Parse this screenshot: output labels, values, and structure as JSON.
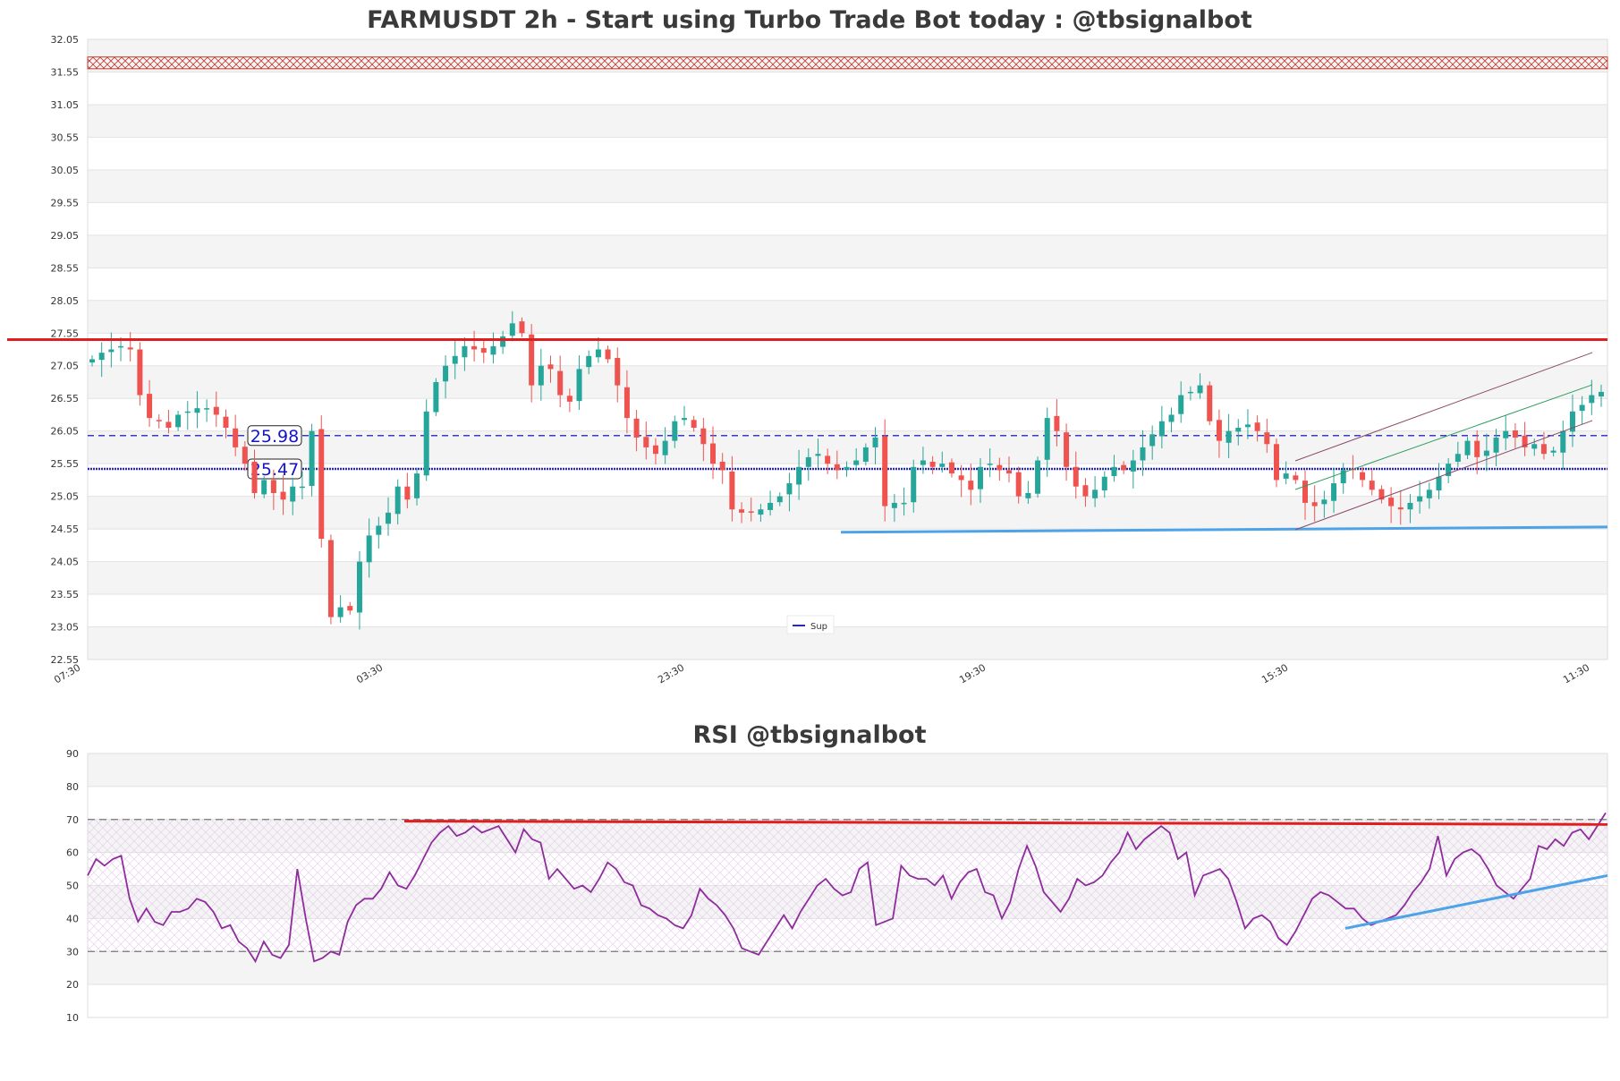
{
  "main_chart": {
    "title": "FARMUSDT 2h - Start using Turbo Trade Bot today : @tbsignalbot",
    "y_ticks": [
      "22.55",
      "23.05",
      "23.55",
      "24.05",
      "24.55",
      "25.05",
      "25.55",
      "26.05",
      "26.55",
      "27.05",
      "27.55",
      "28.05",
      "28.55",
      "29.05",
      "29.55",
      "30.05",
      "30.55",
      "31.05",
      "31.55",
      "32.05"
    ],
    "x_ticks": [
      "07:30",
      "03:30",
      "23:30",
      "19:30",
      "15:30",
      "11:30"
    ],
    "level_labels": [
      "25.98",
      "25.47"
    ],
    "legend_label": "Sup",
    "colors": {
      "up": "#26a69a",
      "down": "#ef5350",
      "resistance": "#e01e1e",
      "support_line": "#4da3e8",
      "level": "#2a2ab0",
      "zone": "#c0392b"
    }
  },
  "rsi_chart": {
    "title": "RSI @tbsignalbot",
    "y_ticks": [
      "10",
      "20",
      "30",
      "40",
      "50",
      "60",
      "70",
      "80",
      "90"
    ],
    "colors": {
      "rsi": "#8e2c9c",
      "resistance": "#e01e1e",
      "support_line": "#4da3e8",
      "band": "#777777"
    }
  },
  "chart_data": [
    {
      "type": "candlestick",
      "title": "FARMUSDT 2h - Start using Turbo Trade Bot today : @tbsignalbot",
      "ylim": [
        22.55,
        32.05
      ],
      "x_tick_labels": [
        "07:30",
        "03:30",
        "23:30",
        "19:30",
        "15:30",
        "11:30"
      ],
      "resistance_zone": [
        31.6,
        31.78
      ],
      "horizontal_levels": [
        25.98,
        25.47
      ],
      "resistance_line": 27.45,
      "support_line": {
        "start_y": 24.5,
        "end_y": 24.58
      },
      "close_path": [
        27.15,
        27.25,
        27.3,
        27.35,
        27.3,
        26.6,
        26.25,
        26.2,
        26.1,
        26.3,
        26.35,
        26.4,
        26.4,
        26.3,
        26.1,
        25.8,
        25.55,
        25.1,
        25.3,
        25.1,
        25.0,
        25.2,
        25.2,
        26.05,
        24.4,
        23.2,
        23.35,
        23.3,
        24.05,
        24.45,
        24.6,
        24.8,
        25.2,
        25.0,
        25.4,
        26.35,
        26.8,
        27.05,
        27.2,
        27.35,
        27.3,
        27.25,
        27.35,
        27.5,
        27.7,
        27.55,
        26.75,
        27.05,
        27.0,
        26.6,
        26.5,
        27.0,
        27.2,
        27.3,
        27.15,
        26.75,
        26.25,
        25.95,
        25.8,
        25.7,
        25.9,
        26.2,
        26.25,
        26.1,
        25.85,
        25.55,
        25.45,
        24.85,
        24.8,
        24.8,
        24.85,
        24.95,
        25.05,
        25.25,
        25.5,
        25.65,
        25.7,
        25.55,
        25.45,
        25.5,
        25.6,
        25.8,
        25.95,
        24.9,
        24.95,
        24.95,
        25.5,
        25.6,
        25.5,
        25.55,
        25.4,
        25.3,
        25.15,
        25.5,
        25.55,
        25.45,
        25.4,
        25.05,
        25.1,
        25.6,
        26.25,
        26.05,
        25.5,
        25.2,
        25.05,
        25.15,
        25.35,
        25.5,
        25.45,
        25.6,
        25.8,
        26.0,
        26.2,
        26.3,
        26.6,
        26.65,
        26.75,
        26.2,
        25.9,
        26.05,
        26.1,
        26.15,
        26.05,
        25.85,
        25.3,
        25.4,
        25.3,
        24.95,
        24.9,
        25.0,
        25.25,
        25.45,
        25.45,
        25.3,
        25.15,
        25.0,
        24.9,
        24.85,
        24.95,
        25.05,
        25.15,
        25.35,
        25.55,
        25.7,
        25.9,
        25.65,
        25.75,
        25.95,
        26.05,
        25.95,
        25.8,
        25.85,
        25.7,
        25.75,
        26.05,
        26.35,
        26.45,
        26.6,
        26.65
      ]
    },
    {
      "type": "line",
      "title": "RSI @tbsignalbot",
      "ylim": [
        10,
        90
      ],
      "bands": [
        30,
        70
      ],
      "resistance_line": {
        "start_y": 69.5,
        "end_y": 68.5
      },
      "support_line": {
        "start_y": 37,
        "end_y": 53
      },
      "values": [
        53,
        58,
        56,
        58,
        59,
        46,
        39,
        43,
        39,
        38,
        42,
        42,
        43,
        46,
        45,
        42,
        37,
        38,
        33,
        31,
        27,
        33,
        29,
        28,
        32,
        55,
        40,
        27,
        28,
        30,
        29,
        39,
        44,
        46,
        46,
        49,
        54,
        50,
        49,
        53,
        58,
        63,
        66,
        68,
        65,
        66,
        68,
        66,
        67,
        68,
        64,
        60,
        67,
        64,
        63,
        52,
        55,
        52,
        49,
        50,
        48,
        52,
        57,
        55,
        51,
        50,
        44,
        43,
        41,
        40,
        38,
        37,
        41,
        49,
        46,
        44,
        41,
        37,
        31,
        30,
        29,
        33,
        37,
        41,
        37,
        42,
        46,
        50,
        52,
        49,
        47,
        48,
        55,
        57,
        38,
        39,
        40,
        56,
        53,
        52,
        52,
        50,
        53,
        46,
        51,
        54,
        55,
        48,
        47,
        40,
        45,
        55,
        62,
        56,
        48,
        45,
        42,
        46,
        52,
        50,
        51,
        53,
        57,
        60,
        66,
        61,
        64,
        66,
        68,
        66,
        58,
        60,
        47,
        53,
        54,
        55,
        52,
        45,
        37,
        40,
        41,
        39,
        34,
        32,
        36,
        41,
        46,
        48,
        47,
        45,
        43,
        43,
        40,
        38,
        39,
        40,
        41,
        44,
        48,
        51,
        55,
        65,
        53,
        58,
        60,
        61,
        59,
        55,
        50,
        48,
        46,
        49,
        52,
        62,
        61,
        64,
        62,
        66,
        67,
        64,
        68,
        72
      ]
    }
  ]
}
